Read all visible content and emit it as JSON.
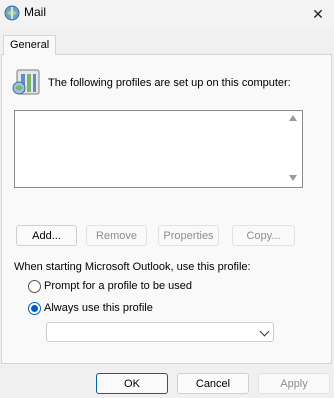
{
  "window": {
    "title": "Mail",
    "close_glyph": "✕"
  },
  "tabs": [
    {
      "label": "General"
    }
  ],
  "profiles": {
    "header": "The following profiles are set up on this computer:",
    "items": []
  },
  "buttons": {
    "add": "Add...",
    "remove": "Remove",
    "properties": "Properties",
    "copy": "Copy..."
  },
  "startup": {
    "label": "When starting Microsoft Outlook, use this profile:",
    "options": [
      {
        "label": "Prompt for a profile to be used",
        "selected": false
      },
      {
        "label": "Always use this profile",
        "selected": true
      }
    ],
    "profile_value": ""
  },
  "footer": {
    "ok": "OK",
    "cancel": "Cancel",
    "apply": "Apply"
  },
  "icons": {
    "window": "mail-app-icon",
    "header": "mail-profiles-icon"
  },
  "colors": {
    "accent": "#005fb8"
  }
}
